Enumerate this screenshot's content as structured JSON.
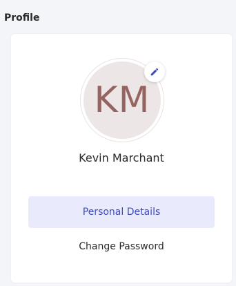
{
  "section_title": "Profile",
  "profile": {
    "initials": "KM",
    "name": "Kevin Marchant",
    "avatar_bg": "#ede6e6",
    "initials_color": "#956360",
    "edit_icon": "pencil-icon"
  },
  "menu": {
    "items": [
      {
        "label": "Personal Details",
        "active": true
      },
      {
        "label": "Change Password",
        "active": false
      }
    ]
  },
  "colors": {
    "accent": "#3d4bbd",
    "accent_bg": "#e9ebfc"
  }
}
